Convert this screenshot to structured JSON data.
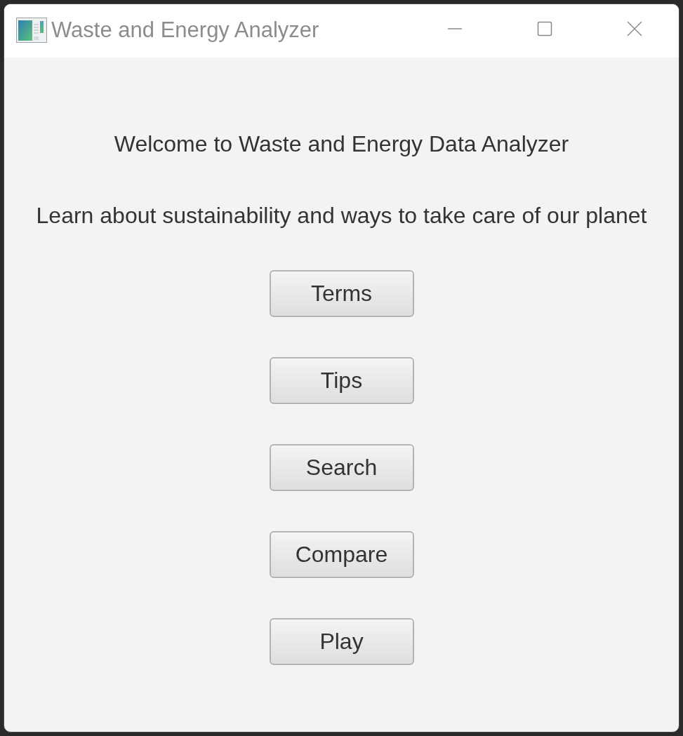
{
  "window": {
    "title": "Waste and Energy Analyzer"
  },
  "headings": [
    "Welcome to Waste and Energy Data Analyzer",
    "Learn about sustainability and ways to take care of our planet"
  ],
  "buttons": [
    "Terms",
    "Tips",
    "Search",
    "Compare",
    "Play"
  ]
}
